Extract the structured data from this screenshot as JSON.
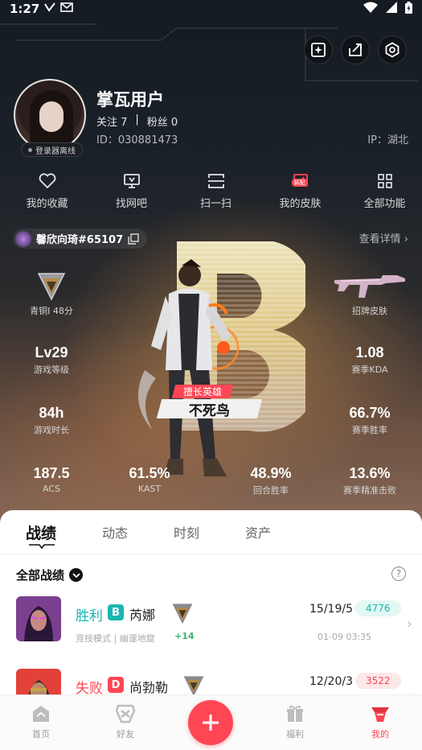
{
  "status_bar": {
    "time": "1:27"
  },
  "profile": {
    "username": "掌瓦用户",
    "following": "关注 7",
    "separator": "|",
    "followers": "粉丝 0",
    "uid": "ID：030881473",
    "ip": "IP：湖北",
    "avatar_badge": "登录器离线"
  },
  "quick_menu": [
    {
      "label": "我的收藏",
      "icon": "heart-icon"
    },
    {
      "label": "找网吧",
      "icon": "monitor-icon"
    },
    {
      "label": "扫一扫",
      "icon": "scan-icon"
    },
    {
      "label": "我的皮肤",
      "icon": "skin-icon",
      "tag": "装配"
    },
    {
      "label": "全部功能",
      "icon": "grid-icon"
    }
  ],
  "game_card": {
    "player_name": "馨欣向琦#65107",
    "detail_link": "查看详情",
    "rank_label": "青铜I 48分",
    "skin_label": "招牌皮肤",
    "level": {
      "value": "Lv29",
      "label": "游戏等级"
    },
    "kda": {
      "value": "1.08",
      "label": "赛季KDA"
    },
    "playtime": {
      "value": "84h",
      "label": "游戏时长"
    },
    "winrate": {
      "value": "66.7%",
      "label": "赛季胜率"
    },
    "acs": {
      "value": "187.5",
      "label": "ACS"
    },
    "kast": {
      "value": "61.5%",
      "label": "KAST"
    },
    "round_winrate": {
      "value": "48.9%",
      "label": "回合胜率"
    },
    "headshot": {
      "value": "13.6%",
      "label": "赛季精准击败"
    },
    "best_agent_title": "擅长英雄",
    "best_agent_name": "不死鸟",
    "grade_letter": "B"
  },
  "tabs": [
    "战绩",
    "动态",
    "时刻",
    "资产"
  ],
  "filter_label": "全部战绩",
  "help_icon": "?",
  "matches": [
    {
      "result": "胜利",
      "result_color": "#19b6b0",
      "grade": "B",
      "grade_color": "#19b6b0",
      "agent": "芮娜",
      "mode": "竞技模式 | 幽邃地窟",
      "rank_delta": "+14",
      "kda": "15/19/5",
      "score": "4776",
      "score_bg": "#e3f7f3",
      "score_color": "#19b6b0",
      "date": "01-09 03:35"
    },
    {
      "result": "失败",
      "result_color": "#ff4655",
      "grade": "D",
      "grade_color": "#ff4655",
      "agent": "尚勃勒",
      "mode": "",
      "rank_delta": "",
      "kda": "12/20/3",
      "score": "3522",
      "score_bg": "#fde8e9",
      "score_color": "#ff4655",
      "date": ""
    }
  ],
  "bottom_nav": [
    {
      "label": "首页",
      "icon": "home-icon"
    },
    {
      "label": "好友",
      "icon": "friends-icon"
    },
    {
      "label": "福利",
      "icon": "gift-icon"
    },
    {
      "label": "我的",
      "icon": "me-icon"
    }
  ],
  "colors": {
    "accent": "#ff4655",
    "win": "#19b6b0"
  }
}
